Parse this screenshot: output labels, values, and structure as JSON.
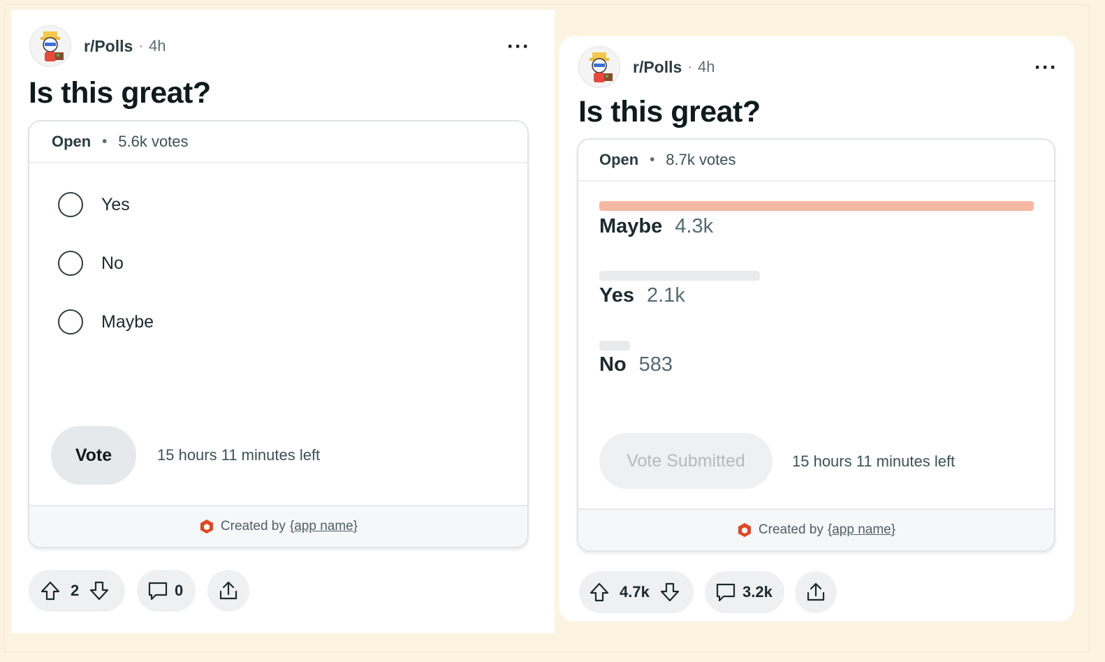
{
  "colors": {
    "page_bg": "#fdf3e1",
    "result_bar_winner": "#f4b8a3",
    "result_bar_other": "#e8ebec",
    "brand_icon": "#e5461f"
  },
  "left": {
    "subreddit": "r/Polls",
    "age": "4h",
    "title": "Is this great?",
    "status": "Open",
    "votes": "5.6k votes",
    "options": [
      "Yes",
      "No",
      "Maybe"
    ],
    "vote_button": "Vote",
    "time_left": "15 hours 11 minutes left",
    "created_by_prefix": "Created by",
    "app_name": "{app name}",
    "upvotes": "2",
    "comments": "0"
  },
  "right": {
    "subreddit": "r/Polls",
    "age": "4h",
    "title": "Is this great?",
    "status": "Open",
    "votes": "8.7k votes",
    "results": [
      {
        "label": "Maybe",
        "count": "4.3k",
        "fraction": 1.0
      },
      {
        "label": "Yes",
        "count": "2.1k",
        "fraction": 0.37
      },
      {
        "label": "No",
        "count": "583",
        "fraction": 0.07
      }
    ],
    "vote_button": "Vote Submitted",
    "time_left": "15 hours 11 minutes left",
    "created_by_prefix": "Created by",
    "app_name": "{app name}",
    "upvotes": "4.7k",
    "comments": "3.2k"
  }
}
